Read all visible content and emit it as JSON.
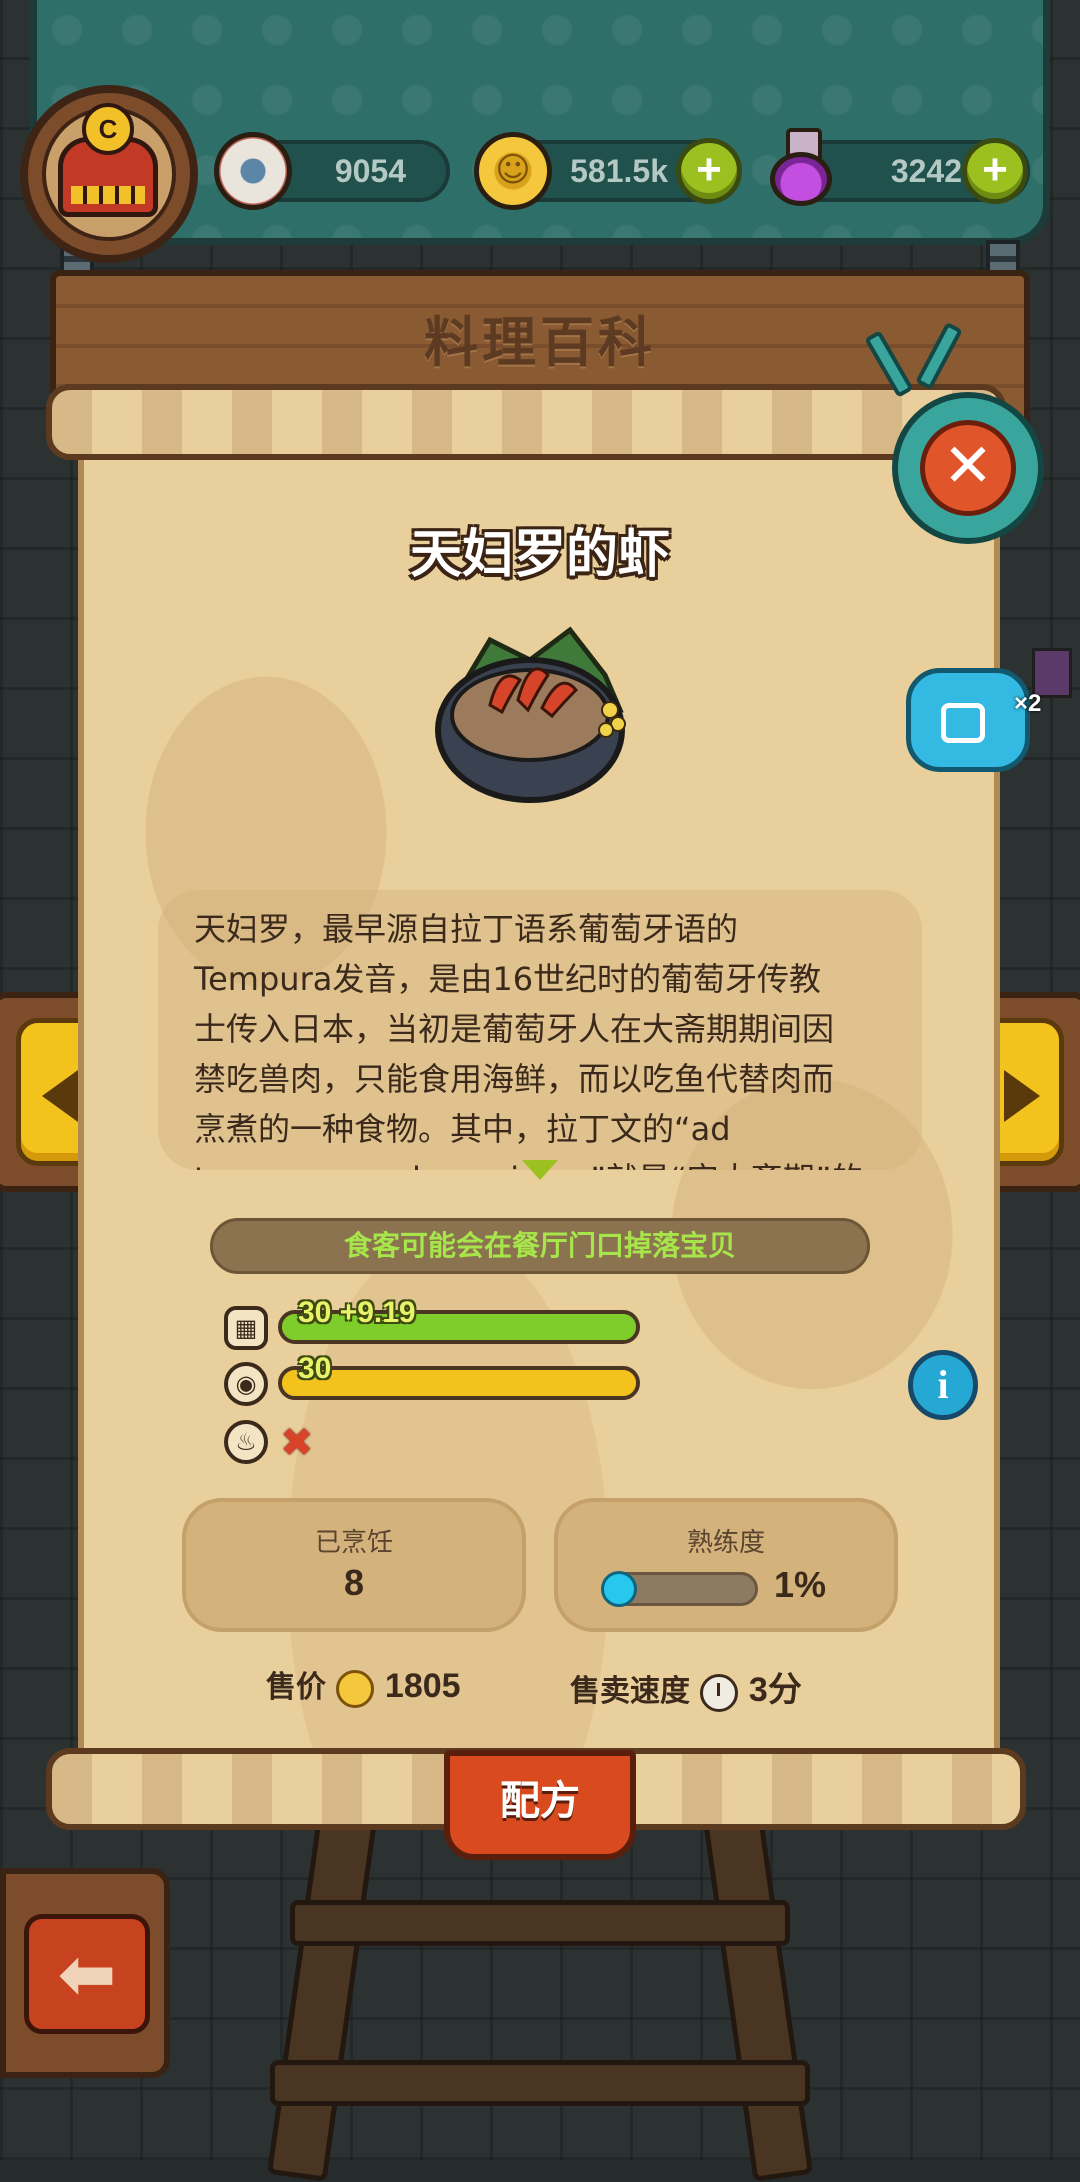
{
  "hud": {
    "avatar_badge": "C",
    "resources": [
      {
        "icon": "eyeball-icon",
        "value": "9054"
      },
      {
        "icon": "coin-icon",
        "value": "581.5k"
      },
      {
        "icon": "potion-icon",
        "value": "3242"
      }
    ],
    "plus_label": "+"
  },
  "header": {
    "title": "料理百科"
  },
  "dish": {
    "name": "天妇罗的虾",
    "description": "天妇罗，最早源自拉丁语系葡萄牙语的\nTempura发音，是由16世纪时的葡萄牙传教\n士传入日本，当初是葡萄牙人在大斋期期间因\n禁吃兽肉，只能食用海鲜，而以吃鱼代替肉而\n烹煮的一种食物。其中，拉丁文的“ad\ntempora quadragesimae”就是“守大斋期”的",
    "drop_banner": "食客可能会在餐厅门口掉落宝贝"
  },
  "stats": [
    {
      "icon": "taste-icon",
      "value_label": "30 +9.19",
      "fill": 1.0,
      "color": "#7fcd2a"
    },
    {
      "icon": "appearance-eye-icon",
      "value_label": "30",
      "fill": 1.0,
      "color": "#f3c21c"
    }
  ],
  "stat_fire": {
    "icon": "fire-icon",
    "value": "✖"
  },
  "cooked": {
    "label": "已烹饪",
    "value": "8"
  },
  "mastery": {
    "label": "熟练度",
    "value": "1%",
    "fraction": 0.01
  },
  "sale": {
    "price_label": "售价",
    "price_value": "1805",
    "speed_label": "售卖速度",
    "speed_value": "3分"
  },
  "buttons": {
    "recipe": "配方",
    "close": "✕",
    "info": "i",
    "back": "⬅",
    "share_count": "×2"
  }
}
